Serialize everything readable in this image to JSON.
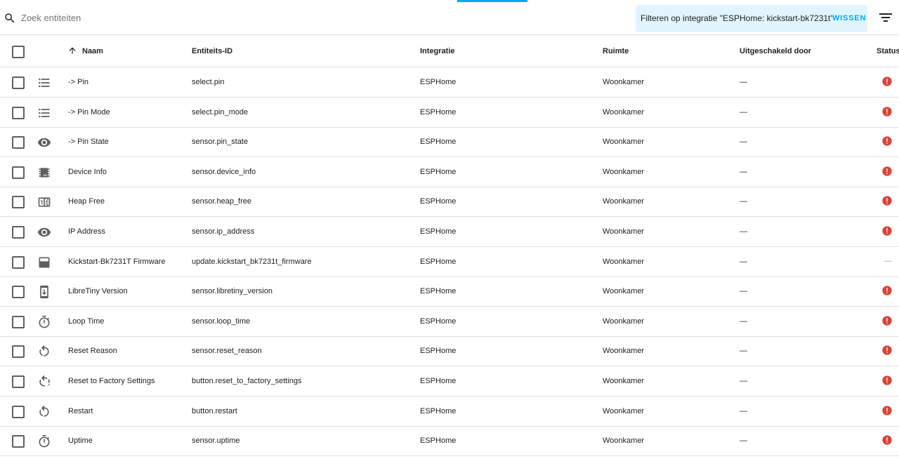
{
  "search": {
    "placeholder": "Zoek entiteiten",
    "icon": "search-icon"
  },
  "filter": {
    "text": "Filteren op integratie \"ESPHome: kickstart-bk7231t\"",
    "clear_label": "WISSEN",
    "accent": "#03a9f4",
    "chip_bg": "#e1f5fe"
  },
  "table": {
    "columns": {
      "name": "Naam",
      "entity_id": "Entiteits-ID",
      "integration": "Integratie",
      "area": "Ruimte",
      "disabled_by": "Uitgeschakeld door",
      "status": "Status"
    },
    "sort": {
      "column": "name",
      "direction": "ascending",
      "icon": "arrow-up-icon"
    },
    "rows": [
      {
        "icon": "format-list-icon",
        "name": "-> Pin",
        "entity_id": "select.pin",
        "integration": "ESPHome",
        "area": "Woonkamer",
        "disabled_by": "—",
        "status": "unavailable"
      },
      {
        "icon": "format-list-icon",
        "name": "-> Pin Mode",
        "entity_id": "select.pin_mode",
        "integration": "ESPHome",
        "area": "Woonkamer",
        "disabled_by": "—",
        "status": "unavailable"
      },
      {
        "icon": "eye-icon",
        "name": "-> Pin State",
        "entity_id": "sensor.pin_state",
        "integration": "ESPHome",
        "area": "Woonkamer",
        "disabled_by": "—",
        "status": "unavailable"
      },
      {
        "icon": "chip-icon",
        "name": "Device Info",
        "entity_id": "sensor.device_info",
        "integration": "ESPHome",
        "area": "Woonkamer",
        "disabled_by": "—",
        "status": "unavailable"
      },
      {
        "icon": "counter-icon",
        "name": "Heap Free",
        "entity_id": "sensor.heap_free",
        "integration": "ESPHome",
        "area": "Woonkamer",
        "disabled_by": "—",
        "status": "unavailable"
      },
      {
        "icon": "eye-icon",
        "name": "IP Address",
        "entity_id": "sensor.ip_address",
        "integration": "ESPHome",
        "area": "Woonkamer",
        "disabled_by": "—",
        "status": "unavailable"
      },
      {
        "icon": "package-icon",
        "name": "Kickstart-Bk7231T Firmware",
        "entity_id": "update.kickstart_bk7231t_firmware",
        "integration": "ESPHome",
        "area": "Woonkamer",
        "disabled_by": "—",
        "status": "—"
      },
      {
        "icon": "cellphone-arrow-down-icon",
        "name": "LibreTiny Version",
        "entity_id": "sensor.libretiny_version",
        "integration": "ESPHome",
        "area": "Woonkamer",
        "disabled_by": "—",
        "status": "unavailable"
      },
      {
        "icon": "timer-icon",
        "name": "Loop Time",
        "entity_id": "sensor.loop_time",
        "integration": "ESPHome",
        "area": "Woonkamer",
        "disabled_by": "—",
        "status": "unavailable"
      },
      {
        "icon": "restart-icon",
        "name": "Reset Reason",
        "entity_id": "sensor.reset_reason",
        "integration": "ESPHome",
        "area": "Woonkamer",
        "disabled_by": "—",
        "status": "unavailable"
      },
      {
        "icon": "restart-alert-icon",
        "name": "Reset to Factory Settings",
        "entity_id": "button.reset_to_factory_settings",
        "integration": "ESPHome",
        "area": "Woonkamer",
        "disabled_by": "—",
        "status": "unavailable"
      },
      {
        "icon": "restart-icon",
        "name": "Restart",
        "entity_id": "button.restart",
        "integration": "ESPHome",
        "area": "Woonkamer",
        "disabled_by": "—",
        "status": "unavailable"
      },
      {
        "icon": "timer-icon",
        "name": "Uptime",
        "entity_id": "sensor.uptime",
        "integration": "ESPHome",
        "area": "Woonkamer",
        "disabled_by": "—",
        "status": "unavailable"
      }
    ]
  },
  "colors": {
    "status_error": "#db4437",
    "icon": "#5f5f5f",
    "divider": "#e0e0e0"
  }
}
